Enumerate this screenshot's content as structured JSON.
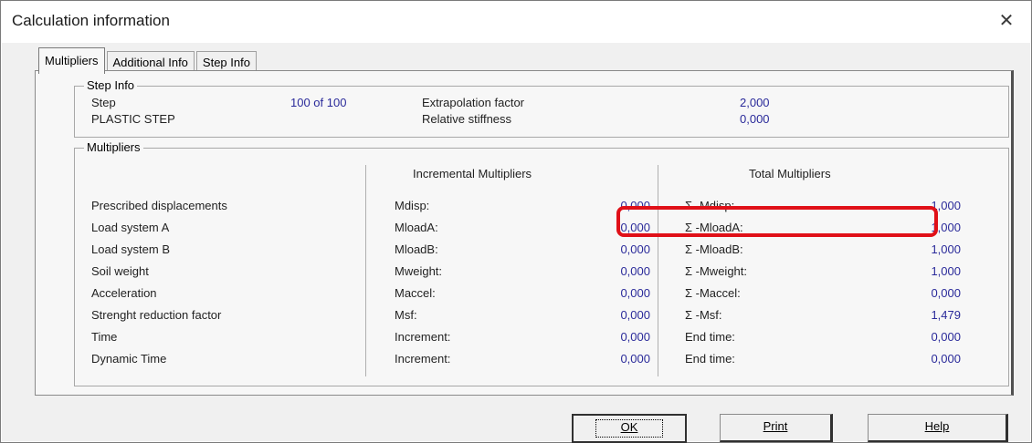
{
  "window": {
    "title": "Calculation information",
    "close_glyph": "✕"
  },
  "tabs": [
    {
      "label": "Multipliers"
    },
    {
      "label": "Additional Info"
    },
    {
      "label": "Step Info"
    }
  ],
  "step_info": {
    "group_title": "Step Info",
    "step_label": "Step",
    "step_value": "100 of 100",
    "plastic_label": "PLASTIC STEP",
    "extrapolation_label": "Extrapolation factor",
    "extrapolation_value": "2,000",
    "relative_label": "Relative stiffness",
    "relative_value": "0,000"
  },
  "multipliers": {
    "group_title": "Multipliers",
    "incremental_header": "Incremental Multipliers",
    "total_header": "Total Multipliers",
    "rows": [
      {
        "label": "Prescribed displacements",
        "inc_name": "Mdisp:",
        "inc_value": "0,000",
        "tot_name": "Σ -Mdisp:",
        "tot_value": "1,000"
      },
      {
        "label": "Load system A",
        "inc_name": "MloadA:",
        "inc_value": "0,000",
        "tot_name": "Σ -MloadA:",
        "tot_value": "1,000"
      },
      {
        "label": "Load system B",
        "inc_name": "MloadB:",
        "inc_value": "0,000",
        "tot_name": "Σ -MloadB:",
        "tot_value": "1,000"
      },
      {
        "label": "Soil weight",
        "inc_name": "Mweight:",
        "inc_value": "0,000",
        "tot_name": "Σ -Mweight:",
        "tot_value": "1,000"
      },
      {
        "label": "Acceleration",
        "inc_name": "Maccel:",
        "inc_value": "0,000",
        "tot_name": "Σ -Maccel:",
        "tot_value": "0,000"
      },
      {
        "label": "Strenght reduction factor",
        "inc_name": "Msf:",
        "inc_value": "0,000",
        "tot_name": "Σ -Msf:",
        "tot_value": "1,479"
      },
      {
        "label": "Time",
        "inc_name": "Increment:",
        "inc_value": "0,000",
        "tot_name": "End time:",
        "tot_value": "0,000"
      },
      {
        "label": "Dynamic Time",
        "inc_name": "Increment:",
        "inc_value": "0,000",
        "tot_name": "End time:",
        "tot_value": "0,000"
      }
    ]
  },
  "buttons": {
    "ok": "OK",
    "print": "Print",
    "help": "Help"
  },
  "colors": {
    "value_blue": "#2a2a9a",
    "highlight_red": "#e01018"
  }
}
